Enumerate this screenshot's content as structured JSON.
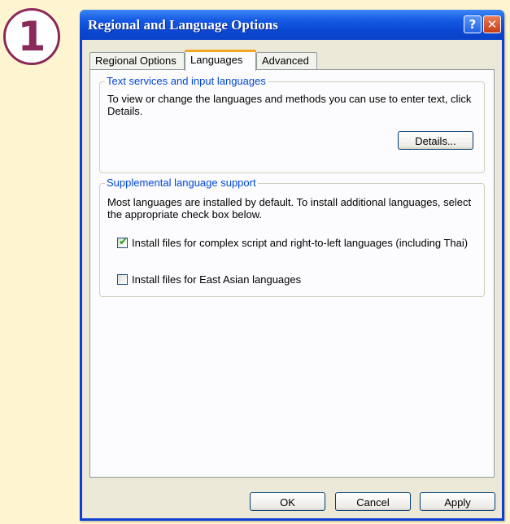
{
  "badge": {
    "number": "1"
  },
  "window": {
    "title": "Regional and Language Options",
    "help_glyph": "?",
    "close_glyph": "✕"
  },
  "tabs": [
    {
      "label": "Regional Options",
      "active": false
    },
    {
      "label": "Languages",
      "active": true
    },
    {
      "label": "Advanced",
      "active": false
    }
  ],
  "text_services": {
    "label": "Text services and input languages",
    "description": "To view or change the languages and methods you can use to enter text, click Details.",
    "details_button": "Details..."
  },
  "supplemental": {
    "label": "Supplemental language support",
    "description": "Most languages are installed by default. To install additional languages, select the appropriate check box below.",
    "options": [
      {
        "label": "Install files for complex script and right-to-left languages (including Thai)",
        "checked": true
      },
      {
        "label": "Install files for East Asian languages",
        "checked": false
      }
    ]
  },
  "footer": {
    "ok": "OK",
    "cancel": "Cancel",
    "apply": "Apply"
  }
}
